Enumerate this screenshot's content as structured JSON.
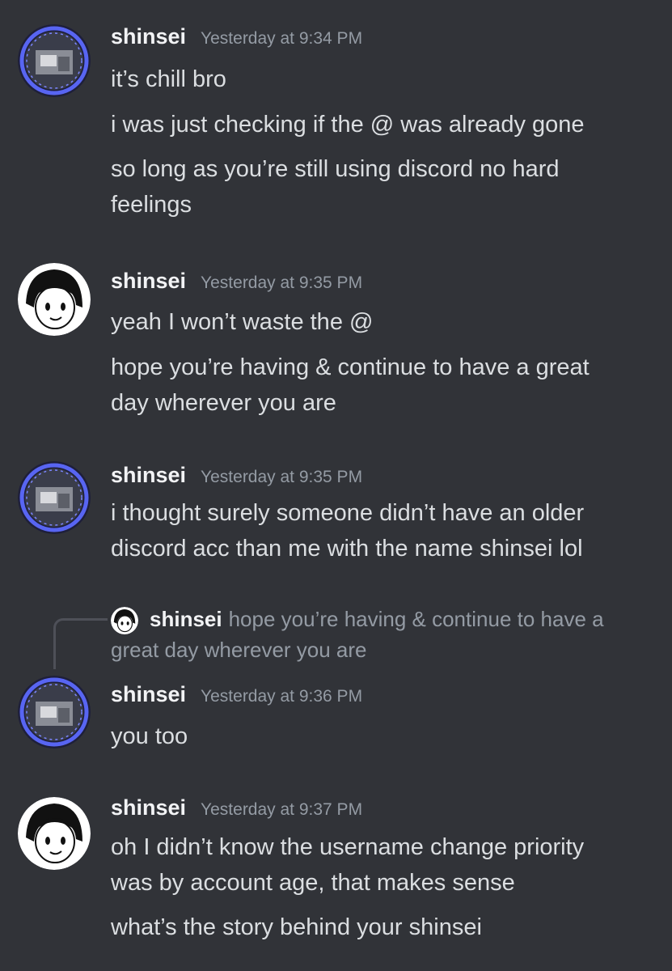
{
  "messages": [
    {
      "username": "shinsei",
      "timestamp": "Yesterday at 9:34 PM",
      "avatar": "blue-ring-photo-avatar",
      "lines": [
        "it’s chill bro",
        "i was just checking if the @ was already gone",
        "so long as you’re still using discord no hard",
        "feelings"
      ]
    },
    {
      "username": "shinsei",
      "timestamp": "Yesterday at 9:35 PM",
      "avatar": "anime-girl-avatar",
      "lines": [
        "yeah I won’t waste the @",
        "hope you’re having & continue to have a great",
        "day wherever you are"
      ]
    },
    {
      "username": "shinsei",
      "timestamp": "Yesterday at 9:35 PM",
      "avatar": "blue-ring-photo-avatar",
      "lines": [
        "i thought surely someone didn’t have an older",
        "discord acc than me with the name shinsei lol"
      ]
    },
    {
      "username": "shinsei",
      "timestamp": "Yesterday at 9:36 PM",
      "avatar": "blue-ring-photo-avatar",
      "reply": {
        "username": "shinsei",
        "text": "hope you’re having & continue to have a great day wherever you are"
      },
      "lines": [
        "you too"
      ]
    },
    {
      "username": "shinsei",
      "timestamp": "Yesterday at 9:37 PM",
      "avatar": "anime-girl-avatar",
      "lines": [
        "oh I didn’t know the username change priority",
        "was by account age, that makes sense",
        "what’s the story behind your shinsei"
      ]
    }
  ],
  "colors": {
    "background": "#313338",
    "username": "#f2f3f5",
    "timestamp": "#949ba4",
    "text": "#dbdee1",
    "reply_spine": "#4e5058",
    "avatar_ring": "#5865f2"
  }
}
